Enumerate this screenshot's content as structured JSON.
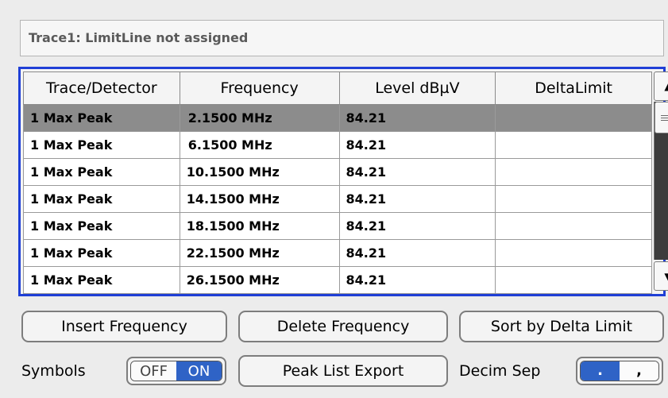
{
  "info": {
    "text": "Trace1: LimitLine not assigned"
  },
  "table": {
    "headers": [
      "Trace/Detector",
      "Frequency",
      "Level dBµV",
      "DeltaLimit"
    ],
    "rows": [
      [
        "1 Max Peak",
        "2.1500 MHz",
        "84.21",
        ""
      ],
      [
        "1 Max Peak",
        "6.1500 MHz",
        "84.21",
        ""
      ],
      [
        "1 Max Peak",
        "10.1500 MHz",
        "84.21",
        ""
      ],
      [
        "1 Max Peak",
        "14.1500 MHz",
        "84.21",
        ""
      ],
      [
        "1 Max Peak",
        "18.1500 MHz",
        "84.21",
        ""
      ],
      [
        "1 Max Peak",
        "22.1500 MHz",
        "84.21",
        ""
      ],
      [
        "1 Max Peak",
        "26.1500 MHz",
        "84.21",
        ""
      ]
    ],
    "selected_row": 0
  },
  "scrollbar": {
    "up_glyph": "▲",
    "down_glyph": "▼"
  },
  "buttons": {
    "insert_frequency": "Insert Frequency",
    "delete_frequency": "Delete Frequency",
    "sort_by_delta_limit": "Sort by Delta Limit",
    "peak_list_export": "Peak List Export"
  },
  "symbols": {
    "label": "Symbols",
    "off": "OFF",
    "on": "ON",
    "state": "ON"
  },
  "decim_sep": {
    "label": "Decim Sep",
    "option_a": ".",
    "option_b": ",",
    "selected": "."
  },
  "colors": {
    "accent": "#2f63c6",
    "frame": "#1f3fd6",
    "selected_row": "#8c8c8c"
  }
}
